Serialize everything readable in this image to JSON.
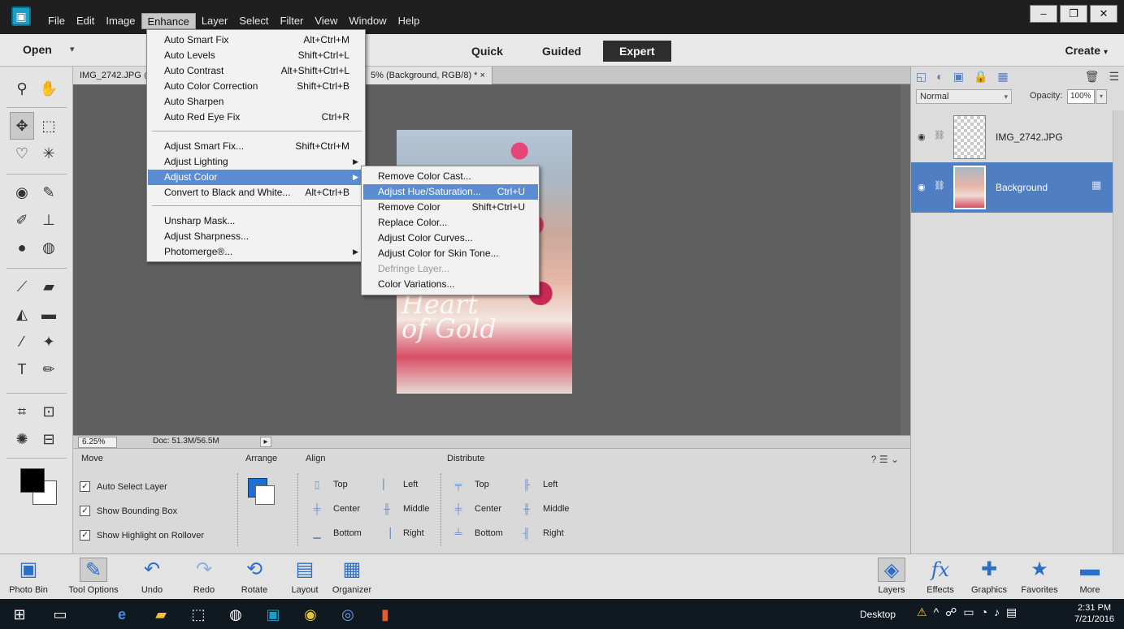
{
  "menubar": {
    "logo": "PS",
    "items": [
      "File",
      "Edit",
      "Image",
      "Enhance",
      "Layer",
      "Select",
      "Filter",
      "View",
      "Window",
      "Help"
    ],
    "active_index": 3,
    "window_controls": [
      "–",
      "❐",
      "✕"
    ]
  },
  "modebar": {
    "open": "Open",
    "modes": [
      "Quick",
      "Guided",
      "Expert"
    ],
    "active_mode": "Expert",
    "create": "Create"
  },
  "document": {
    "tab_left": "IMG_2742.JPG @",
    "tab_right": "5% (Background, RGB/8) * ×",
    "photo_text": "Heart of Gold",
    "zoom": "6.25%",
    "doc_size": "Doc: 51.3M/56.5M"
  },
  "enhance_menu": {
    "items": [
      {
        "label": "Auto Smart Fix",
        "shortcut": "Alt+Ctrl+M"
      },
      {
        "label": "Auto Levels",
        "shortcut": "Shift+Ctrl+L"
      },
      {
        "label": "Auto Contrast",
        "shortcut": "Alt+Shift+Ctrl+L"
      },
      {
        "label": "Auto Color Correction",
        "shortcut": "Shift+Ctrl+B"
      },
      {
        "label": "Auto Sharpen",
        "shortcut": ""
      },
      {
        "label": "Auto Red Eye Fix",
        "shortcut": "Ctrl+R"
      },
      {
        "label": "Adjust Smart Fix...",
        "shortcut": "Shift+Ctrl+M"
      },
      {
        "label": "Adjust Lighting",
        "shortcut": ""
      },
      {
        "label": "Adjust Color",
        "shortcut": ""
      },
      {
        "label": "Convert to Black and White...",
        "shortcut": "Alt+Ctrl+B"
      },
      {
        "label": "Unsharp Mask...",
        "shortcut": ""
      },
      {
        "label": "Adjust Sharpness...",
        "shortcut": ""
      },
      {
        "label": "Photomerge®...",
        "shortcut": ""
      }
    ]
  },
  "adjust_color_submenu": {
    "items": [
      {
        "label": "Remove Color Cast...",
        "shortcut": ""
      },
      {
        "label": "Adjust Hue/Saturation...",
        "shortcut": "Ctrl+U"
      },
      {
        "label": "Remove Color",
        "shortcut": "Shift+Ctrl+U"
      },
      {
        "label": "Replace Color...",
        "shortcut": ""
      },
      {
        "label": "Adjust Color Curves...",
        "shortcut": ""
      },
      {
        "label": "Adjust Color for Skin Tone...",
        "shortcut": ""
      },
      {
        "label": "Defringe Layer...",
        "shortcut": ""
      },
      {
        "label": "Color Variations...",
        "shortcut": ""
      }
    ]
  },
  "tool_options": {
    "move": "Move",
    "arrange": "Arrange",
    "align": "Align",
    "distribute": "Distribute",
    "auto_select_layer": "Auto Select Layer",
    "show_bounding_box": "Show Bounding Box",
    "show_highlight": "Show Highlight on Rollover",
    "align_items": [
      "Top",
      "Center",
      "Bottom",
      "Left",
      "Middle",
      "Right"
    ],
    "distribute_items": [
      "Top",
      "Center",
      "Bottom",
      "Left",
      "Middle",
      "Right"
    ]
  },
  "layers_panel": {
    "blend_mode": "Normal",
    "opacity_label": "Opacity:",
    "opacity_value": "100%",
    "layers": [
      {
        "name": "IMG_2742.JPG",
        "selected": false
      },
      {
        "name": "Background",
        "selected": true
      }
    ]
  },
  "panelbar": {
    "left": [
      "Photo Bin",
      "Tool Options",
      "Undo",
      "Redo",
      "Rotate",
      "Layout",
      "Organizer"
    ],
    "right": [
      "Layers",
      "Effects",
      "Graphics",
      "Favorites",
      "More"
    ]
  },
  "taskbar": {
    "desktop": "Desktop",
    "time": "2:31 PM",
    "date": "7/21/2016"
  },
  "colors": {
    "highlight": "#5b8cd1",
    "layer_selected": "#4f7ec2"
  }
}
